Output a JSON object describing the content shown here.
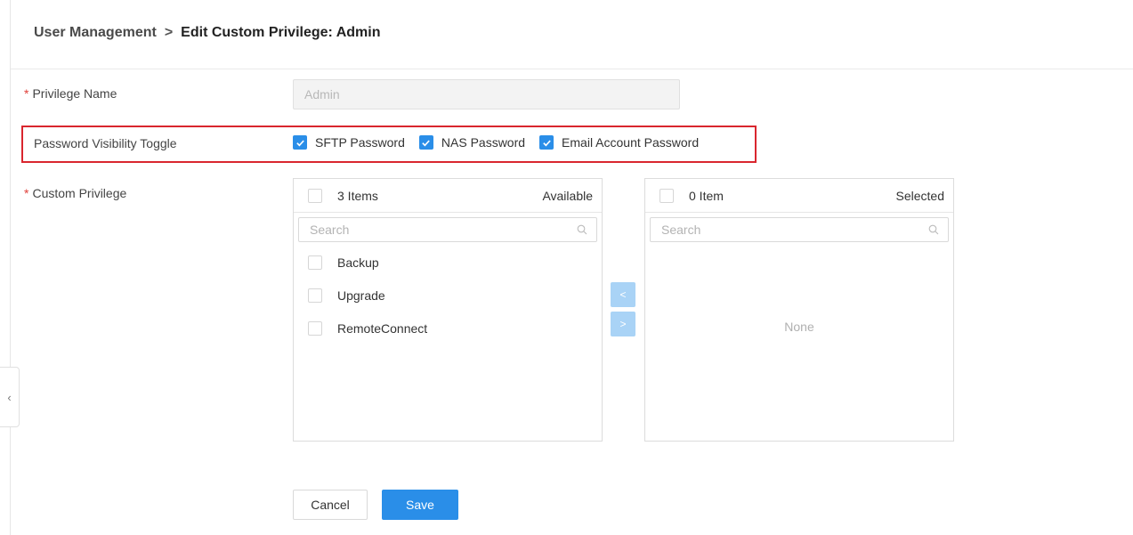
{
  "breadcrumb": {
    "parent": "User Management",
    "separator": ">",
    "current": "Edit Custom Privilege: Admin"
  },
  "form": {
    "privilege_name": {
      "label": "Privilege Name",
      "value": "Admin"
    },
    "password_visibility": {
      "label": "Password Visibility Toggle",
      "options": [
        {
          "label": "SFTP Password",
          "checked": true
        },
        {
          "label": "NAS Password",
          "checked": true
        },
        {
          "label": "Email Account Password",
          "checked": true
        }
      ]
    },
    "custom_privilege": {
      "label": "Custom Privilege"
    }
  },
  "transfer": {
    "available": {
      "count_label": "3 Items",
      "title": "Available",
      "search_placeholder": "Search",
      "items": [
        "Backup",
        "Upgrade",
        "RemoteConnect"
      ]
    },
    "selected": {
      "count_label": "0 Item",
      "title": "Selected",
      "search_placeholder": "Search",
      "empty_text": "None"
    },
    "move_left_icon": "<",
    "move_right_icon": ">"
  },
  "actions": {
    "cancel_label": "Cancel",
    "save_label": "Save"
  },
  "colors": {
    "accent": "#2a8ee8",
    "highlight": "#d9262e",
    "required": "#e0403a"
  }
}
